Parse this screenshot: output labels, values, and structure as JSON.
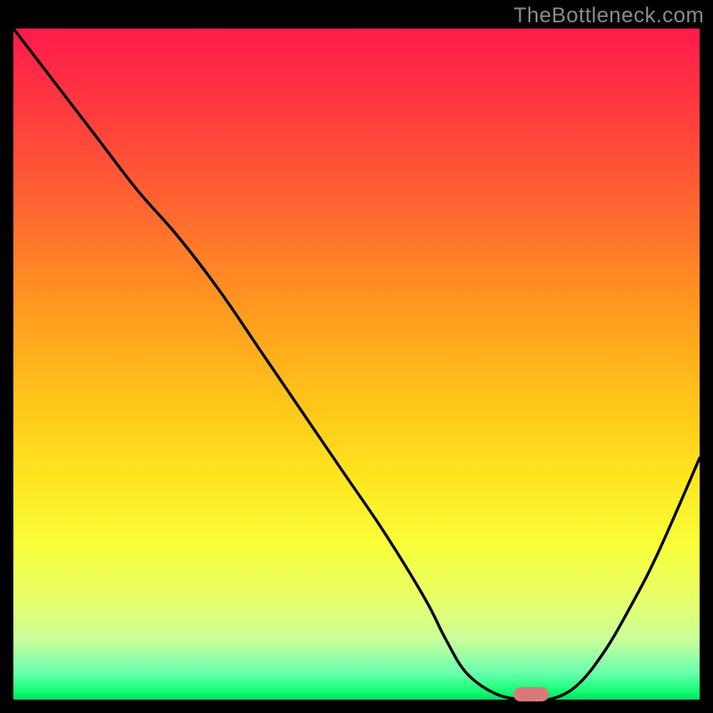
{
  "watermark": "TheBottleneck.com",
  "chart_data": {
    "type": "line",
    "title": "",
    "xlabel": "",
    "ylabel": "",
    "xlim": [
      0,
      100
    ],
    "ylim": [
      0,
      100
    ],
    "grid": false,
    "legend": false,
    "series": [
      {
        "name": "bottleneck-curve",
        "x": [
          0,
          6,
          12,
          18,
          24,
          30,
          36,
          42,
          48,
          54,
          60,
          63,
          66,
          70,
          74,
          78,
          82,
          86,
          90,
          94,
          100
        ],
        "y": [
          100,
          92,
          84,
          76,
          69,
          61,
          52,
          43,
          34,
          25,
          15,
          9,
          4,
          1,
          0,
          0,
          2,
          7,
          14,
          22,
          36
        ]
      }
    ],
    "marker": {
      "x": 75.5,
      "y": 0
    },
    "background_gradient": {
      "top": "#ff1a4b",
      "bottom": "#00e060"
    }
  }
}
